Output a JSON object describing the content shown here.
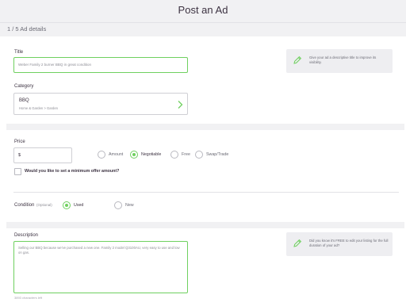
{
  "header": {
    "title": "Post an Ad"
  },
  "progress": {
    "step_label": "1 / 5 Ad details"
  },
  "title_section": {
    "label": "Title",
    "value": "Weber Family 2 burner BBQ in great condition",
    "tip": "Give your ad a descriptive title to improve its visibility."
  },
  "category": {
    "label": "Category",
    "name": "BBQ",
    "path": "Home & Garden > Garden"
  },
  "price": {
    "label": "Price",
    "value": "$",
    "options": [
      {
        "label": "Amount",
        "selected": false
      },
      {
        "label": "Negotiable",
        "selected": true
      },
      {
        "label": "Free",
        "selected": false
      },
      {
        "label": "Swap/Trade",
        "selected": false
      }
    ],
    "min_offer_label": "Would you like to set a minimum offer amount?"
  },
  "condition": {
    "label": "Condition",
    "optional_label": "(Optional)",
    "options": [
      {
        "label": "Used",
        "selected": true
      },
      {
        "label": "New",
        "selected": false
      }
    ]
  },
  "description": {
    "label": "Description",
    "value": "Selling our BBQ because we've purchased a new one. Family 2 model Q3100AU, very easy to use and low on gas.",
    "tip": "Did you know it's FREE to edit your listing for the full duration of your ad?",
    "counter": "3893 characters left"
  },
  "colors": {
    "accent": "#6fd05f",
    "background": "#f1f1f3",
    "text": "#3c3241"
  },
  "icons": {
    "tip_icon": "pencil-icon",
    "category_chevron": "chevron-right-icon"
  }
}
